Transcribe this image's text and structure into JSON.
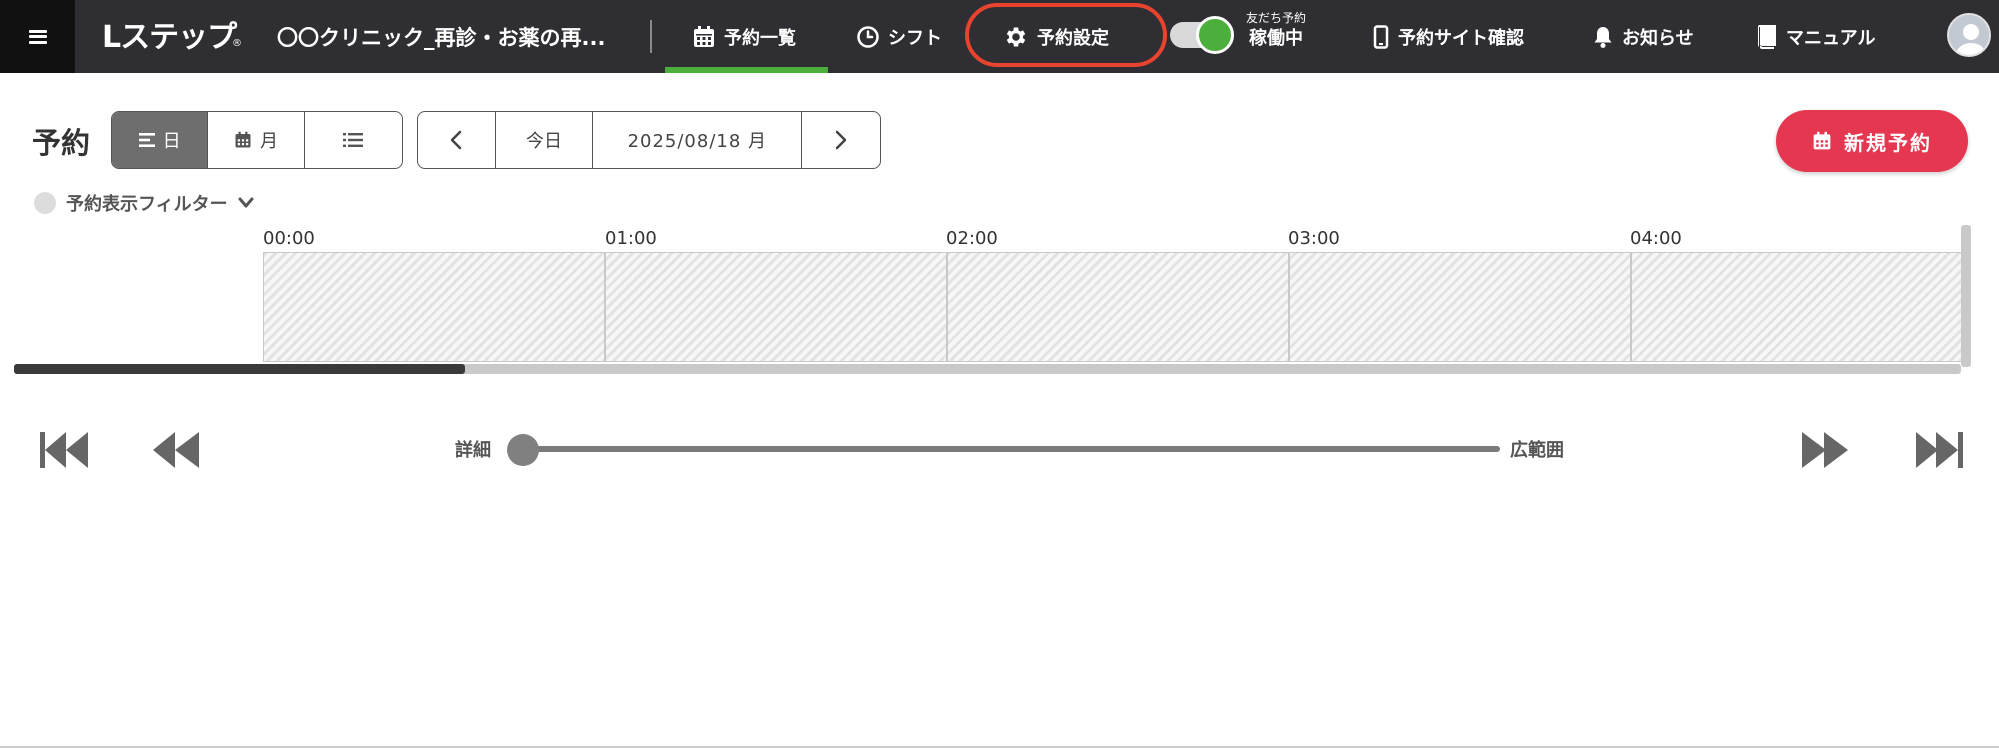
{
  "header": {
    "logo_text": "Lステップ",
    "logo_reg": "®",
    "account_name": "〇〇クリニック_再診・お薬の再...",
    "nav": [
      {
        "label": "予約一覧",
        "icon": "calendar-icon",
        "active": true
      },
      {
        "label": "シフト",
        "icon": "clock-icon"
      },
      {
        "label": "予約設定",
        "icon": "gear-icon",
        "highlighted": true
      },
      {
        "label": "予約サイト確認",
        "icon": "smartphone-icon"
      },
      {
        "label": "お知らせ",
        "icon": "bell-icon"
      },
      {
        "label": "マニュアル",
        "icon": "book-icon"
      }
    ],
    "toggle": {
      "small_label": "友だち予約",
      "status_label": "稼働中",
      "on": true
    },
    "colors": {
      "bar": "#2f2f33",
      "active": "#4cae3c",
      "highlight_ring": "#e8432f"
    }
  },
  "toolbar": {
    "title": "予約",
    "view_day": "日",
    "view_month": "月",
    "view_list_icon": "list-icon",
    "prev_icon": "chevron-left-icon",
    "today": "今日",
    "date": "2025/08/18 月",
    "next_icon": "chevron-right-icon",
    "new_button": "新規予約",
    "new_button_color": "#e53750"
  },
  "filter": {
    "label": "予約表示フィルター"
  },
  "timeline": {
    "hours": [
      "00:00",
      "01:00",
      "02:00",
      "03:00",
      "04:00"
    ],
    "scroll_position": 0.23
  },
  "zoom": {
    "left_label": "詳細",
    "right_label": "広範囲",
    "level": 0
  }
}
